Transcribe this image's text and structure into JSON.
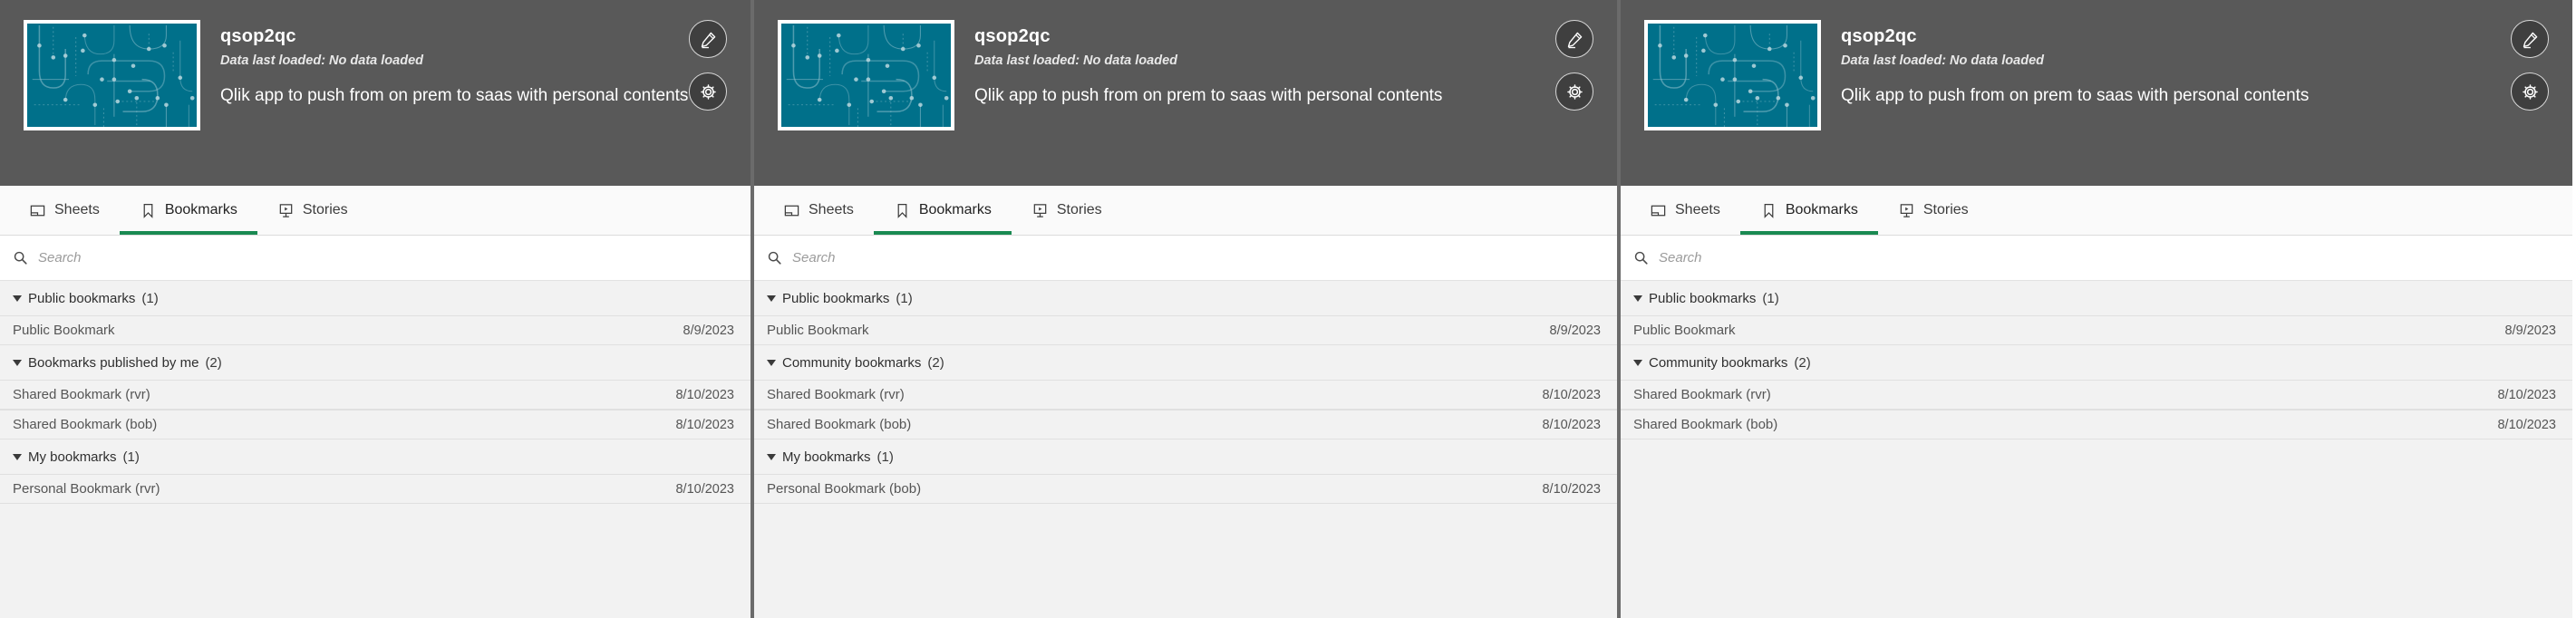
{
  "colors": {
    "header_bg": "#595959",
    "thumb_teal": "#00708a",
    "accent_green": "#1a8a52",
    "list_bg": "#f2f2f2",
    "divider": "#6b6b6b"
  },
  "common": {
    "app_title": "qsop2qc",
    "data_status": "Data last loaded: No data loaded",
    "app_description": "Qlik app to push from on prem to saas with personal contents",
    "edit_button_label": "Edit",
    "settings_button_label": "App options",
    "search_placeholder": "Search",
    "search_value": "",
    "tabs": [
      {
        "label": "Sheets",
        "icon": "sheets-icon",
        "active": false
      },
      {
        "label": "Bookmarks",
        "icon": "bookmark-icon",
        "active": true
      },
      {
        "label": "Stories",
        "icon": "story-icon",
        "active": false
      }
    ]
  },
  "panels": [
    {
      "id": "panel-1",
      "groups": [
        {
          "title": "Public bookmarks",
          "count": "(1)",
          "items": [
            {
              "name": "Public Bookmark",
              "date": "8/9/2023"
            }
          ]
        },
        {
          "title": "Bookmarks published by me",
          "count": "(2)",
          "items": [
            {
              "name": "Shared Bookmark (rvr)",
              "date": "8/10/2023"
            },
            {
              "name": "Shared Bookmark (bob)",
              "date": "8/10/2023"
            }
          ]
        },
        {
          "title": "My bookmarks",
          "count": "(1)",
          "items": [
            {
              "name": "Personal Bookmark (rvr)",
              "date": "8/10/2023"
            }
          ]
        }
      ]
    },
    {
      "id": "panel-2",
      "groups": [
        {
          "title": "Public bookmarks",
          "count": "(1)",
          "items": [
            {
              "name": "Public Bookmark",
              "date": "8/9/2023"
            }
          ]
        },
        {
          "title": "Community bookmarks",
          "count": "(2)",
          "items": [
            {
              "name": "Shared Bookmark (rvr)",
              "date": "8/10/2023"
            },
            {
              "name": "Shared Bookmark (bob)",
              "date": "8/10/2023"
            }
          ]
        },
        {
          "title": "My bookmarks",
          "count": "(1)",
          "items": [
            {
              "name": "Personal Bookmark (bob)",
              "date": "8/10/2023"
            }
          ]
        }
      ]
    },
    {
      "id": "panel-3",
      "groups": [
        {
          "title": "Public bookmarks",
          "count": "(1)",
          "items": [
            {
              "name": "Public Bookmark",
              "date": "8/9/2023"
            }
          ]
        },
        {
          "title": "Community bookmarks",
          "count": "(2)",
          "items": [
            {
              "name": "Shared Bookmark (rvr)",
              "date": "8/10/2023"
            },
            {
              "name": "Shared Bookmark (bob)",
              "date": "8/10/2023"
            }
          ]
        }
      ]
    }
  ]
}
